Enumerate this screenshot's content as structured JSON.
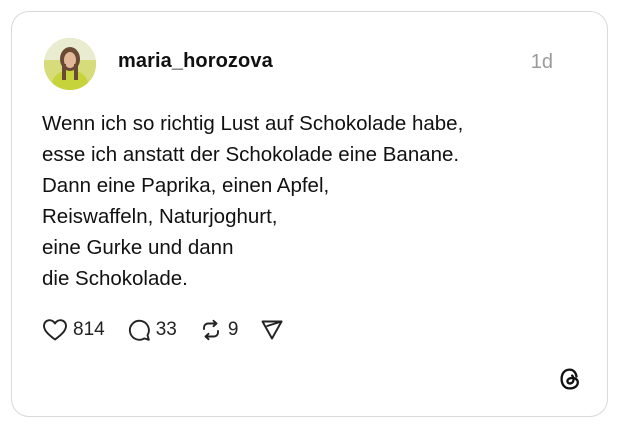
{
  "post": {
    "username": "maria_horozova",
    "timestamp": "1d",
    "lines": [
      "Wenn ich so richtig Lust auf Schokolade habe,",
      "esse ich anstatt der Schokolade eine Banane.",
      "Dann eine Paprika, einen Apfel,",
      "Reiswaffeln, Naturjoghurt,",
      "eine Gurke und dann",
      "die Schokolade."
    ]
  },
  "actions": {
    "likes": "814",
    "replies": "33",
    "reposts": "9"
  },
  "icons": {
    "like": "heart-icon",
    "reply": "comment-bubble-icon",
    "repost": "repost-icon",
    "share": "send-icon",
    "brand": "threads-logo-icon"
  },
  "colors": {
    "text": "#111111",
    "muted": "#9a9a9a",
    "border": "#d9d9d9"
  }
}
